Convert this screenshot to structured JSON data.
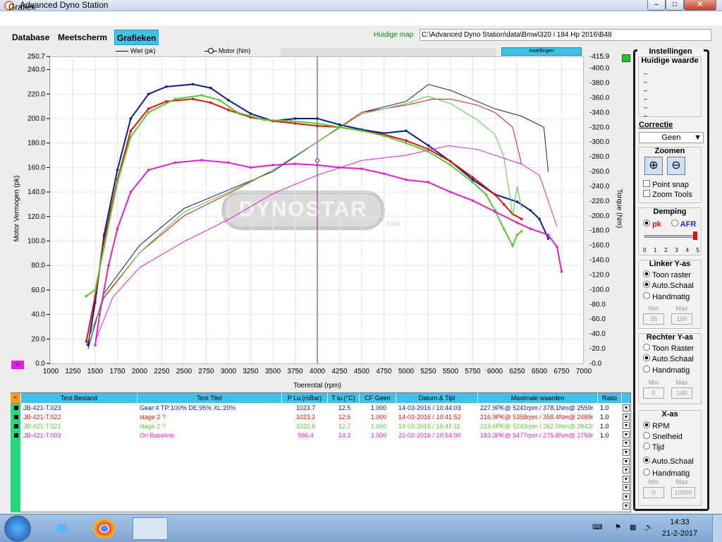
{
  "window": {
    "title": "Advanced Dyno Station"
  },
  "menu": {
    "grafiek": "Grafiek"
  },
  "tabs": [
    {
      "label": "Database"
    },
    {
      "label": "Meetscherm"
    },
    {
      "label": "Grafieken",
      "active": true
    }
  ],
  "huidige_map": {
    "label": "Huidige map",
    "value": "C:\\Advanced Dyno Station\\data\\Bmw\\320 i 184 Hp 2016\\B48"
  },
  "legend": {
    "wiel": "Wiel (pk)",
    "motor": "Motor (Nm)"
  },
  "instellingen_button": "Instellingen",
  "pink_button": ">",
  "watermark": {
    "brand": "DYNOSTAR",
    "com": ".com"
  },
  "chart_data": {
    "type": "line",
    "xlabel": "Toerental (rpm)",
    "ylabel": "Motor Vermogen (pk)",
    "y2label": "Torque (Nm)",
    "xlim": [
      1000,
      7000
    ],
    "ylim": [
      0,
      250.7
    ],
    "y2lim": [
      0,
      415.9
    ],
    "x_ticks": [
      1000,
      1250,
      1500,
      1750,
      2000,
      2250,
      2500,
      2750,
      3000,
      3250,
      3500,
      3750,
      4000,
      4250,
      4500,
      4750,
      5000,
      5250,
      5500,
      5750,
      6000,
      6250,
      6500,
      6750,
      7000
    ],
    "y_ticks": [
      "0.0",
      "20.0",
      "40.0",
      "60.0",
      "80.0",
      "100.0",
      "120.0",
      "140.0",
      "160.0",
      "180.0",
      "200.0",
      "220.0",
      "240.0",
      "250.7"
    ],
    "y2_ticks": [
      "0.0",
      "20.0",
      "40.0",
      "60.0",
      "80.0",
      "100.0",
      "120.0",
      "140.0",
      "160.0",
      "180.0",
      "200.0",
      "220.0",
      "240.0",
      "260.0",
      "280.0",
      "300.0",
      "320.0",
      "340.0",
      "360.0",
      "380.0",
      "400.0",
      "415.9"
    ],
    "cursor_x": 4000,
    "grid": true,
    "series": [
      {
        "name": "JB-421-T.023",
        "color": "#0b1f8f",
        "power": [
          [
            1420,
            15
          ],
          [
            1500,
            50
          ],
          [
            1600,
            105
          ],
          [
            1750,
            158
          ],
          [
            1900,
            200
          ],
          [
            2100,
            220
          ],
          [
            2300,
            226
          ],
          [
            2600,
            228
          ],
          [
            2800,
            225
          ],
          [
            3000,
            215
          ],
          [
            3250,
            204
          ],
          [
            3500,
            198
          ],
          [
            3750,
            200
          ],
          [
            4000,
            200
          ],
          [
            4250,
            195
          ],
          [
            4500,
            191
          ],
          [
            4750,
            188
          ],
          [
            5000,
            190
          ],
          [
            5250,
            178
          ],
          [
            5500,
            165
          ],
          [
            5750,
            150
          ],
          [
            6000,
            138
          ],
          [
            6250,
            132
          ],
          [
            6400,
            125
          ],
          [
            6500,
            118
          ],
          [
            6600,
            102
          ]
        ],
        "torque": [
          [
            1420,
            20
          ],
          [
            1600,
            95
          ],
          [
            2000,
            160
          ],
          [
            2500,
            210
          ],
          [
            3000,
            235
          ],
          [
            3500,
            260
          ],
          [
            4000,
            300
          ],
          [
            4500,
            340
          ],
          [
            5000,
            355
          ],
          [
            5250,
            378
          ],
          [
            5500,
            370
          ],
          [
            5800,
            355
          ],
          [
            6000,
            345
          ],
          [
            6300,
            335
          ],
          [
            6550,
            320
          ],
          [
            6600,
            260
          ]
        ]
      },
      {
        "name": "JB-421-T.022",
        "color": "#d81414",
        "power": [
          [
            1400,
            18
          ],
          [
            1500,
            55
          ],
          [
            1600,
            100
          ],
          [
            1750,
            150
          ],
          [
            1900,
            190
          ],
          [
            2100,
            208
          ],
          [
            2300,
            214
          ],
          [
            2600,
            216
          ],
          [
            2800,
            213
          ],
          [
            3000,
            207
          ],
          [
            3250,
            201
          ],
          [
            3500,
            198
          ],
          [
            3750,
            196
          ],
          [
            4000,
            194
          ],
          [
            4250,
            193
          ],
          [
            4500,
            190
          ],
          [
            4750,
            187
          ],
          [
            5000,
            182
          ],
          [
            5250,
            175
          ],
          [
            5500,
            165
          ],
          [
            5750,
            152
          ],
          [
            6000,
            138
          ],
          [
            6100,
            130
          ],
          [
            6200,
            122
          ],
          [
            6300,
            118
          ]
        ],
        "torque": [
          [
            1400,
            25
          ],
          [
            1600,
            90
          ],
          [
            2000,
            150
          ],
          [
            2500,
            200
          ],
          [
            3000,
            230
          ],
          [
            3500,
            262
          ],
          [
            4000,
            300
          ],
          [
            4500,
            340
          ],
          [
            5000,
            350
          ],
          [
            5300,
            358
          ],
          [
            5500,
            358
          ],
          [
            5800,
            350
          ],
          [
            6000,
            340
          ],
          [
            6200,
            320
          ],
          [
            6300,
            270
          ]
        ]
      },
      {
        "name": "JB-421-T.021",
        "color": "#5dc832",
        "power": [
          [
            1400,
            55
          ],
          [
            1500,
            60
          ],
          [
            1600,
            95
          ],
          [
            1750,
            148
          ],
          [
            1900,
            185
          ],
          [
            2100,
            205
          ],
          [
            2400,
            216
          ],
          [
            2700,
            219
          ],
          [
            2900,
            215
          ],
          [
            3100,
            205
          ],
          [
            3400,
            199
          ],
          [
            3700,
            198
          ],
          [
            4000,
            196
          ],
          [
            4250,
            193
          ],
          [
            4500,
            190
          ],
          [
            4750,
            186
          ],
          [
            5000,
            180
          ],
          [
            5250,
            173
          ],
          [
            5500,
            162
          ],
          [
            5750,
            148
          ],
          [
            5900,
            138
          ],
          [
            6000,
            125
          ],
          [
            6100,
            110
          ],
          [
            6200,
            96
          ],
          [
            6250,
            105
          ],
          [
            6300,
            108
          ]
        ],
        "torque": [
          [
            1400,
            25
          ],
          [
            1600,
            88
          ],
          [
            2000,
            150
          ],
          [
            2500,
            205
          ],
          [
            3000,
            232
          ],
          [
            3500,
            262
          ],
          [
            4000,
            300
          ],
          [
            4500,
            338
          ],
          [
            5000,
            352
          ],
          [
            5243,
            362
          ],
          [
            5500,
            352
          ],
          [
            5800,
            330
          ],
          [
            6000,
            310
          ],
          [
            6100,
            280
          ],
          [
            6200,
            200
          ],
          [
            6250,
            240
          ],
          [
            6300,
            210
          ]
        ]
      },
      {
        "name": "JB-421-T.003",
        "color": "#e020d0",
        "power": [
          [
            1500,
            15
          ],
          [
            1550,
            40
          ],
          [
            1650,
            80
          ],
          [
            1750,
            110
          ],
          [
            1900,
            140
          ],
          [
            2100,
            158
          ],
          [
            2400,
            164
          ],
          [
            2700,
            166
          ],
          [
            3000,
            164
          ],
          [
            3250,
            160
          ],
          [
            3500,
            162
          ],
          [
            3750,
            163
          ],
          [
            4000,
            162
          ],
          [
            4250,
            160
          ],
          [
            4500,
            159
          ],
          [
            4750,
            155
          ],
          [
            5000,
            150
          ],
          [
            5250,
            148
          ],
          [
            5500,
            140
          ],
          [
            5750,
            133
          ],
          [
            6000,
            124
          ],
          [
            6250,
            115
          ],
          [
            6400,
            110
          ],
          [
            6600,
            105
          ],
          [
            6700,
            95
          ],
          [
            6750,
            75
          ]
        ],
        "torque": [
          [
            1500,
            30
          ],
          [
            1700,
            90
          ],
          [
            2000,
            130
          ],
          [
            2500,
            165
          ],
          [
            3000,
            195
          ],
          [
            3500,
            230
          ],
          [
            4000,
            255
          ],
          [
            4500,
            275
          ],
          [
            5000,
            282
          ],
          [
            5477,
            295
          ],
          [
            5800,
            290
          ],
          [
            6000,
            282
          ],
          [
            6300,
            270
          ],
          [
            6500,
            255
          ],
          [
            6700,
            185
          ]
        ]
      }
    ]
  },
  "table": {
    "orange_btn": "<",
    "headers": [
      "Test Bestand",
      "Test Titel",
      "P Lu.(mBar)",
      "T lu.(°C)",
      "CF Geen",
      "Datum & Tijd",
      "Maximale waarden",
      "Ratio"
    ],
    "rows": [
      {
        "file": "JB-421-T.023",
        "title": "Gear:4 TP:100% DE:95% XL:20%",
        "p": "1023.7",
        "t": "12.5",
        "cf": "1.000",
        "date": "14-03-2016 / 10:44:03",
        "max": "227.9PK@ 5241rpm / 378.1Nm@ 2559r",
        "ratio": "1.0",
        "color": "#0b1f8f"
      },
      {
        "file": "JB-421-T.022",
        "title": "stage 2 ?",
        "p": "1023.2",
        "t": "12.6",
        "cf": "1.000",
        "date": "14-03-2016 / 10:41:52",
        "max": "216.9PK@ 5358rpm / 358.4Nm@ 2489r",
        "ratio": "1.0",
        "color": "#d81414"
      },
      {
        "file": "JB-421-T.021",
        "title": "stage 2 ?",
        "p": "1023.8",
        "t": "12.7",
        "cf": "1.000",
        "date": "14-03-2016 / 10:41:11",
        "max": "219.6PK@ 5243rpm / 362.5Nm@ 2642r",
        "ratio": "1.0",
        "color": "#5dc832"
      },
      {
        "file": "JB-421-T.003",
        "title": "Ori Baseline",
        "p": "996.4",
        "t": "14.3",
        "cf": "1.000",
        "date": "22-02-2016 / 10:54:00",
        "max": "183.3PK@ 5477rpm / 275.8Nm@ 2759r",
        "ratio": "1.0",
        "color": "#e020d0"
      }
    ]
  },
  "panel": {
    "instellingen": "Instellingen",
    "huidige_waarde": "Huidige waarde",
    "dashes": [
      "–",
      "–",
      "–",
      "–",
      "–",
      "–"
    ],
    "correctie": {
      "title": "Correctie",
      "value": "Geen"
    },
    "zoomen": {
      "title": "Zoomen",
      "point_snap": "Point snap",
      "zoom_tools": "Zoom Tools"
    },
    "demping": {
      "title": "Demping",
      "pk": "pk",
      "afr": "AFR",
      "scale": [
        "0",
        "1",
        "2",
        "3",
        "4",
        "5"
      ]
    },
    "linker": {
      "title": "Linker Y-as",
      "toon": "Toon raster",
      "auto": "Auto.Schaal",
      "hand": "Handmatig",
      "min_label": "Min",
      "max_label": "Max",
      "min": "35",
      "max": "150"
    },
    "rechter": {
      "title": "Rechter Y-as",
      "toon": "Toon Raster",
      "auto": "Auto.Schaal",
      "hand": "Handmatig",
      "min_label": "Min",
      "max_label": "Max",
      "min": "0",
      "max": "100"
    },
    "xas": {
      "title": "X-as",
      "rpm": "RPM",
      "snelheid": "Snelheid",
      "tijd": "Tijd",
      "auto": "Auto.Schaal",
      "hand": "Handmatig",
      "min_label": "Min",
      "max_label": "Max",
      "min": "0",
      "max": "10000"
    }
  },
  "clock": {
    "time": "14:33",
    "date": "21-2-2017"
  }
}
